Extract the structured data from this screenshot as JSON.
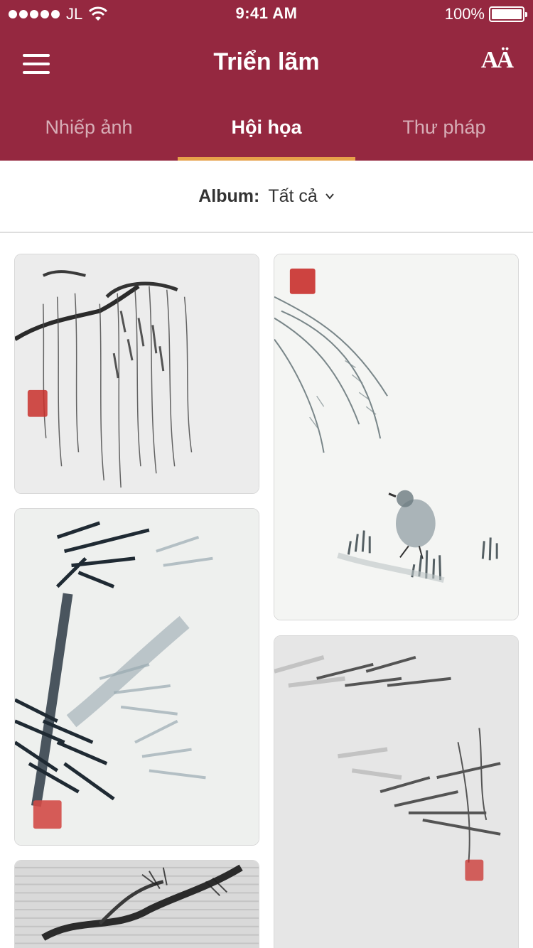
{
  "status_bar": {
    "carrier": "JL",
    "time": "9:41 AM",
    "battery": "100%"
  },
  "nav": {
    "title": "Triển lãm",
    "font_size_icon": "font-size-icon",
    "menu_icon": "hamburger-menu-icon"
  },
  "tabs": [
    {
      "label": "Nhiếp ảnh",
      "active": false
    },
    {
      "label": "Hội họa",
      "active": true
    },
    {
      "label": "Thư pháp",
      "active": false
    }
  ],
  "album": {
    "label": "Album:",
    "value": "Tất cả"
  },
  "gallery": [
    {
      "subject": "willow-branches",
      "column": 0
    },
    {
      "subject": "bird-and-grass",
      "column": 1
    },
    {
      "subject": "bamboo-dark",
      "column": 0
    },
    {
      "subject": "bamboo-light",
      "column": 1
    },
    {
      "subject": "pine-branch",
      "column": 0
    }
  ],
  "colors": {
    "header": "#952840",
    "tab_indicator": "#e7a14a",
    "seal": "#c9302c",
    "ink": "#1f2a33"
  }
}
